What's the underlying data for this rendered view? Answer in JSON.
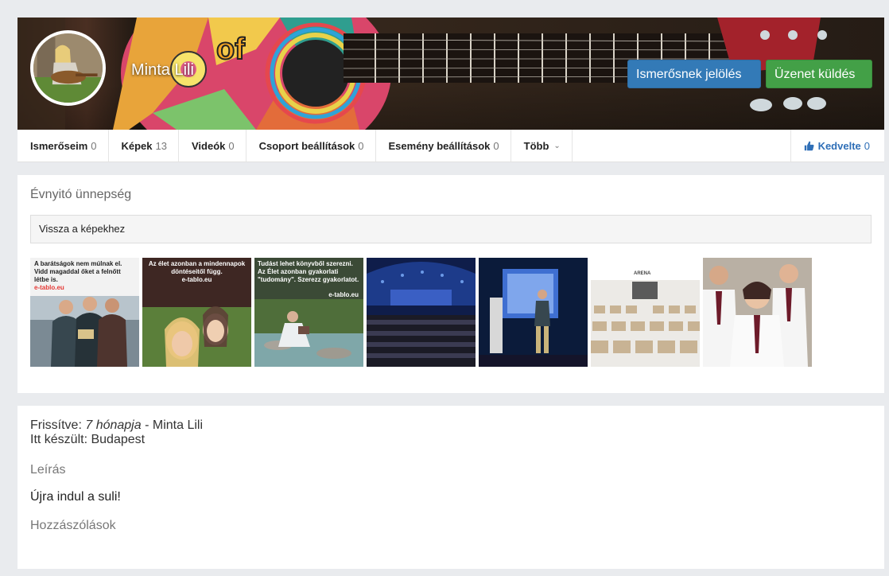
{
  "profile": {
    "name": "Minta Lili",
    "add_friend_label": "Ismerősnek jelölés",
    "send_message_label": "Üzenet küldés"
  },
  "nav": {
    "items": [
      {
        "label": "Ismerőseim",
        "count": "0"
      },
      {
        "label": "Képek",
        "count": "13"
      },
      {
        "label": "Videók",
        "count": "0"
      },
      {
        "label": "Csoport beállítások",
        "count": "0"
      },
      {
        "label": "Esemény beállítások",
        "count": "0"
      }
    ],
    "more_label": "Több",
    "like_label": "Kedvelte",
    "like_count": "0"
  },
  "album": {
    "title": "Évnyitó ünnepség",
    "back_label": "Vissza a képekhez",
    "photos": [
      {
        "caption": "A barátságok nem múlnak el. Vidd magaddal őket a felnőtt létbe is.",
        "brand": "e-tablo.eu"
      },
      {
        "caption": "Az élet azonban a mindennapok döntéseitől függ.",
        "brand": "e-tablo.eu"
      },
      {
        "caption": "Tudást lehet könyvből szerezni. Az Élet azonban gyakorlati \"tudomány\". Szerezz gyakorlatot.",
        "brand": "e-tablo.eu"
      },
      {
        "caption": "",
        "brand": ""
      },
      {
        "caption": "",
        "brand": ""
      },
      {
        "caption": "",
        "brand": "ARENA"
      },
      {
        "caption": "",
        "brand": ""
      }
    ]
  },
  "details": {
    "updated_prefix": "Frissítve:",
    "updated_time": "7 hónapja",
    "updated_sep": "-",
    "updated_by": "Minta Lili",
    "location": "Itt készült: Budapest",
    "description_label": "Leírás",
    "description": "Újra indul a suli!",
    "comments_label": "Hozzászólások"
  },
  "colors": {
    "primary_button": "#337ab7",
    "success_button": "#43a047",
    "like_blue": "#2f6fb7",
    "page_bg": "#e9ebee"
  },
  "icons": {
    "like": "thumbs-up-icon",
    "more": "chevron-down-icon"
  }
}
